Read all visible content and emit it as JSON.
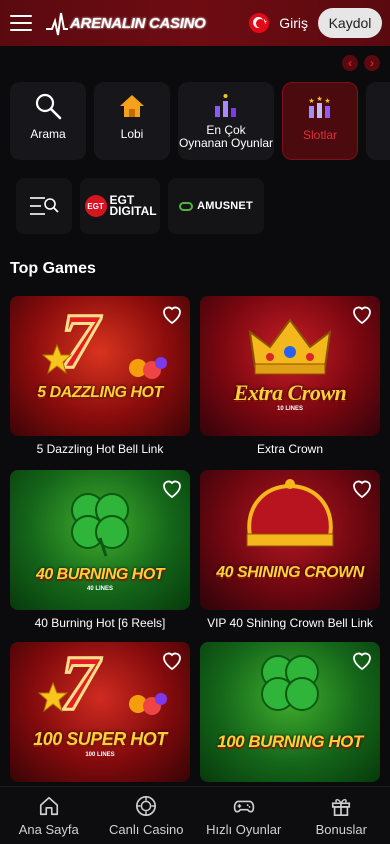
{
  "header": {
    "logo_text": "ARENALIN CASINO",
    "login_label": "Giriş",
    "register_label": "Kaydol"
  },
  "categories": [
    {
      "label": "Arama",
      "icon": "search-icon",
      "active": false
    },
    {
      "label": "Lobi",
      "icon": "home-icon",
      "active": false
    },
    {
      "label": "En Çok\nOynanan Oyunlar",
      "icon": "chart-icon",
      "active": false
    },
    {
      "label": "Slotlar",
      "icon": "slots-icon",
      "active": true
    }
  ],
  "providers": [
    {
      "name": "EGT DIGITAL",
      "badge": "EGT"
    },
    {
      "name": "AMUSNET"
    }
  ],
  "section_title": "Top Games",
  "games": [
    {
      "name": "5 Dazzling Hot Bell Link",
      "art_title": "5 DAZZLING HOT",
      "art_sub": ""
    },
    {
      "name": "Extra Crown",
      "art_title": "Extra Crown",
      "art_sub": "10 LINES"
    },
    {
      "name": "40 Burning Hot [6 Reels]",
      "art_title": "40 BURNING HOT",
      "art_sub": "40 LINES"
    },
    {
      "name": "VIP 40 Shining Crown Bell Link",
      "art_title": "40 SHINING CROWN",
      "art_sub": ""
    },
    {
      "name": "100 Super Hot",
      "art_title": "100 SUPER HOT",
      "art_sub": "100 LINES"
    },
    {
      "name": "100 Burning Hot",
      "art_title": "100 BURNING HOT",
      "art_sub": ""
    }
  ],
  "bottom_nav": [
    {
      "label": "Ana Sayfa",
      "icon": "home-icon"
    },
    {
      "label": "Canlı Casino",
      "icon": "chip-icon"
    },
    {
      "label": "Hızlı Oyunlar",
      "icon": "gamepad-icon"
    },
    {
      "label": "Bonuslar",
      "icon": "gift-icon"
    }
  ],
  "colors": {
    "header_bg": "#6e0c12",
    "accent_red": "#e1303a",
    "page_bg": "#0b0b0d"
  }
}
